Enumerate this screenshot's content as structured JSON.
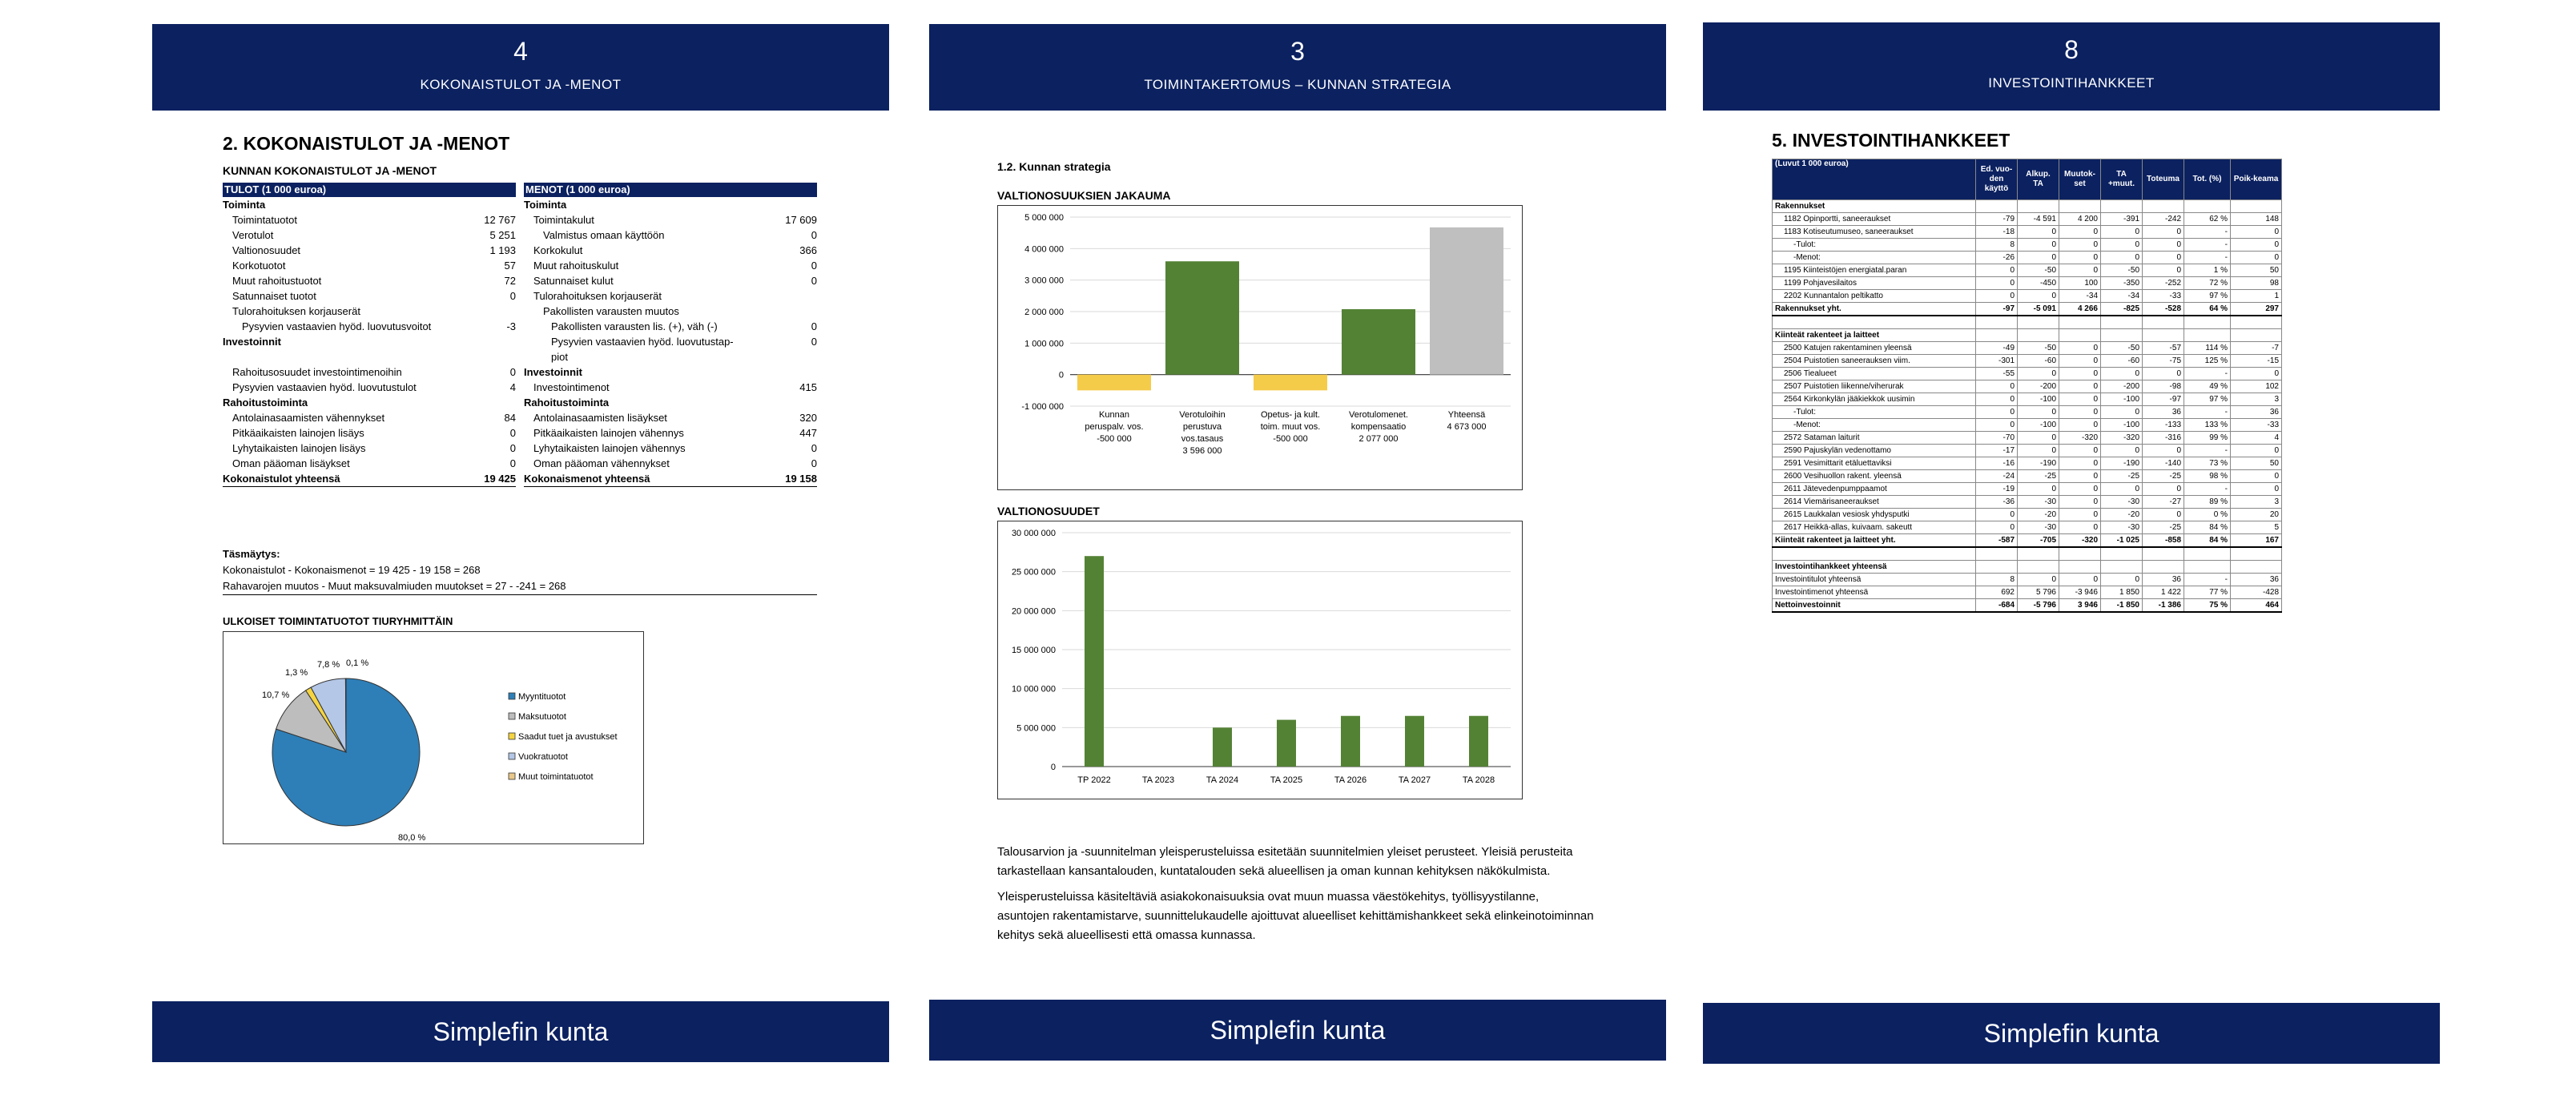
{
  "pages": [
    {
      "number": "4",
      "title": "KOKONAISTULOT JA -MENOT",
      "footer": "Simplefin kunta",
      "heading": "2.  KOKONAISTULOT JA -MENOT",
      "table_title": "KUNNAN KOKONAISTULOT JA -MENOT",
      "income": {
        "header": "TULOT (1 000 euroa)",
        "rows": [
          {
            "label": "Toiminta",
            "value": "",
            "style": "b",
            "indent": 0
          },
          {
            "label": "Toimintatuotot",
            "value": "12 767",
            "style": "",
            "indent": 1
          },
          {
            "label": "Verotulot",
            "value": "5 251",
            "style": "",
            "indent": 1
          },
          {
            "label": "Valtionosuudet",
            "value": "1 193",
            "style": "",
            "indent": 1
          },
          {
            "label": "Korkotuotot",
            "value": "57",
            "style": "",
            "indent": 1
          },
          {
            "label": "Muut rahoitustuotot",
            "value": "72",
            "style": "",
            "indent": 1
          },
          {
            "label": "Satunnaiset tuotot",
            "value": "0",
            "style": "",
            "indent": 1
          },
          {
            "label": "Tulorahoituksen korjauserät",
            "value": "",
            "style": "",
            "indent": 1
          },
          {
            "label": "Pysyvien vastaavien hyöd. luovutusvoitot",
            "value": "-3",
            "style": "",
            "indent": 2
          },
          {
            "label": "Investoinnit",
            "value": "",
            "style": "b",
            "indent": 0
          },
          {
            "label": "",
            "value": "",
            "style": "gap",
            "indent": 0
          },
          {
            "label": "Rahoitusosuudet investointimenoihin",
            "value": "0",
            "style": "",
            "indent": 1
          },
          {
            "label": "Pysyvien vastaavien hyöd. luovutustulot",
            "value": "4",
            "style": "",
            "indent": 1
          },
          {
            "label": "Rahoitustoiminta",
            "value": "",
            "style": "b",
            "indent": 0
          },
          {
            "label": "Antolainasaamisten vähennykset",
            "value": "84",
            "style": "",
            "indent": 1
          },
          {
            "label": "Pitkäaikaisten lainojen lisäys",
            "value": "0",
            "style": "",
            "indent": 1
          },
          {
            "label": "Lyhytaikaisten lainojen lisäys",
            "value": "0",
            "style": "",
            "indent": 1
          },
          {
            "label": "Oman pääoman lisäykset",
            "value": "0",
            "style": "",
            "indent": 1
          },
          {
            "label": "Kokonaistulot yhteensä",
            "value": "19 425",
            "style": "b2",
            "indent": 0
          }
        ]
      },
      "expenses": {
        "header": "MENOT (1 000 euroa)",
        "rows": [
          {
            "label": "Toiminta",
            "value": "",
            "style": "b",
            "indent": 0
          },
          {
            "label": "Toimintakulut",
            "value": "17 609",
            "style": "",
            "indent": 1
          },
          {
            "label": "Valmistus omaan käyttöön",
            "value": "0",
            "style": "",
            "indent": 2
          },
          {
            "label": "Korkokulut",
            "value": "366",
            "style": "",
            "indent": 1
          },
          {
            "label": "Muut rahoituskulut",
            "value": "0",
            "style": "",
            "indent": 1
          },
          {
            "label": "Satunnaiset kulut",
            "value": "0",
            "style": "",
            "indent": 1
          },
          {
            "label": "Tulorahoituksen korjauserät",
            "value": "",
            "style": "",
            "indent": 1
          },
          {
            "label": "Pakollisten varausten muutos",
            "value": "",
            "style": "",
            "indent": 2
          },
          {
            "label": "Pakollisten varausten lis. (+), väh (-)",
            "value": "0",
            "style": "",
            "indent": 3
          },
          {
            "label": "Pysyvien vastaavien hyöd. luovutustap-",
            "value": "0",
            "style": "",
            "indent": 3
          },
          {
            "label": "piot",
            "value": "",
            "style": "",
            "indent": 3
          },
          {
            "label": "Investoinnit",
            "value": "",
            "style": "b",
            "indent": 0
          },
          {
            "label": "Investointimenot",
            "value": "415",
            "style": "",
            "indent": 1
          },
          {
            "label": "Rahoitustoiminta",
            "value": "",
            "style": "b",
            "indent": 0
          },
          {
            "label": "Antolainasaamisten lisäykset",
            "value": "320",
            "style": "",
            "indent": 1
          },
          {
            "label": "Pitkäaikaisten lainojen vähennys",
            "value": "447",
            "style": "",
            "indent": 1
          },
          {
            "label": "Lyhytaikaisten lainojen vähennys",
            "value": "0",
            "style": "",
            "indent": 1
          },
          {
            "label": "Oman pääoman vähennykset",
            "value": "0",
            "style": "",
            "indent": 1
          },
          {
            "label": "Kokonaismenot yhteensä",
            "value": "19 158",
            "style": "b2",
            "indent": 0
          }
        ]
      },
      "reconciliation_title": "Täsmäytys:",
      "reconciliation_line1": "Kokonaistulot - Kokonaismenot  = 19 425 - 19 158 = 268",
      "reconciliation_line2": "Rahavarojen muutos - Muut maksuvalmiuden muutokset = 27 - -241 = 268",
      "pie_title": "ULKOISET TOIMINTATUOTOT TIURYHMITTÄIN"
    },
    {
      "number": "3",
      "title": "TOIMINTAKERTOMUS – KUNNAN STRATEGIA",
      "footer": "Simplefin kunta",
      "section": "1.2. Kunnan strategia",
      "chart1_title": "VALTIONOSUUKSIEN JAKAUMA",
      "chart2_title": "VALTIONOSUUDET",
      "paragraph1": "Talousarvion ja -suunnitelman yleisperusteluissa esitetään suunnitelmien yleiset perusteet. Yleisiä perusteita tarkastellaan kansantalouden, kuntatalouden sekä alueellisen ja oman kunnan kehityksen näkökulmista.",
      "paragraph2": "Yleisperusteluissa käsiteltäviä asiakokonaisuuksia ovat muun muassa väestökehitys, työllisyystilanne, asuntojen rakentamistarve, suunnittelukaudelle ajoittuvat alueelliset kehittämishankkeet sekä elinkeinotoiminnan kehitys sekä alueellisesti että omassa kunnassa."
    },
    {
      "number": "8",
      "title": "INVESTOINTIHANKKEET",
      "footer": "Simplefin kunta",
      "heading": "5.  INVESTOINTIHANKKEET",
      "table": {
        "columns": [
          "(Luvut 1 000 euroa)",
          "Ed. vuo-den käyttö",
          "Alkup. TA",
          "Muutok-set",
          "TA +muut.",
          "Toteuma",
          "Tot. (%)",
          "Poik-keama"
        ],
        "rows": [
          {
            "style": "sec",
            "cells": [
              "Rakennukset",
              "",
              "",
              "",
              "",
              "",
              "",
              ""
            ]
          },
          {
            "style": "",
            "cells": [
              "1182 Opinportti, saneeraukset",
              "-79",
              "-4 591",
              "4 200",
              "-391",
              "-242",
              "62 %",
              "148"
            ]
          },
          {
            "style": "",
            "cells": [
              "1183 Kotiseutumuseo, saneeraukset",
              "-18",
              "0",
              "0",
              "0",
              "0",
              "-",
              "0"
            ]
          },
          {
            "style": "",
            "cells": [
              "-Tulot:",
              "8",
              "0",
              "0",
              "0",
              "0",
              "-",
              "0"
            ]
          },
          {
            "style": "",
            "cells": [
              "-Menot:",
              "-26",
              "0",
              "0",
              "0",
              "0",
              "-",
              "0"
            ]
          },
          {
            "style": "",
            "cells": [
              "1195 Kiinteistöjen energiatal.paran",
              "0",
              "-50",
              "0",
              "-50",
              "0",
              "1 %",
              "50"
            ]
          },
          {
            "style": "",
            "cells": [
              "1199 Pohjavesilaitos",
              "0",
              "-450",
              "100",
              "-350",
              "-252",
              "72 %",
              "98"
            ]
          },
          {
            "style": "",
            "cells": [
              "2202 Kunnantalon peltikatto",
              "0",
              "0",
              "-34",
              "-34",
              "-33",
              "97 %",
              "1"
            ]
          },
          {
            "style": "tot",
            "cells": [
              "Rakennukset yht.",
              "-97",
              "-5 091",
              "4 266",
              "-825",
              "-528",
              "64 %",
              "297"
            ]
          },
          {
            "style": "",
            "cells": [
              "",
              "",
              "",
              "",
              "",
              "",
              "",
              ""
            ]
          },
          {
            "style": "sec",
            "cells": [
              "Kiinteät rakenteet ja laitteet",
              "",
              "",
              "",
              "",
              "",
              "",
              ""
            ]
          },
          {
            "style": "",
            "cells": [
              "2500 Katujen rakentaminen yleensä",
              "-49",
              "-50",
              "0",
              "-50",
              "-57",
              "114 %",
              "-7"
            ]
          },
          {
            "style": "",
            "cells": [
              "2504 Puistotien saneerauksen viim.",
              "-301",
              "-60",
              "0",
              "-60",
              "-75",
              "125 %",
              "-15"
            ]
          },
          {
            "style": "",
            "cells": [
              "2506 Tiealueet",
              "-55",
              "0",
              "0",
              "0",
              "0",
              "-",
              "0"
            ]
          },
          {
            "style": "",
            "cells": [
              "2507 Puistotien liikenne/viherurak",
              "0",
              "-200",
              "0",
              "-200",
              "-98",
              "49 %",
              "102"
            ]
          },
          {
            "style": "",
            "cells": [
              "2564 Kirkonkylän jääkiekkok uusimin",
              "0",
              "-100",
              "0",
              "-100",
              "-97",
              "97 %",
              "3"
            ]
          },
          {
            "style": "",
            "cells": [
              "-Tulot:",
              "0",
              "0",
              "0",
              "0",
              "36",
              "-",
              "36"
            ]
          },
          {
            "style": "",
            "cells": [
              "-Menot:",
              "0",
              "-100",
              "0",
              "-100",
              "-133",
              "133 %",
              "-33"
            ]
          },
          {
            "style": "",
            "cells": [
              "2572 Sataman laiturit",
              "-70",
              "0",
              "-320",
              "-320",
              "-316",
              "99 %",
              "4"
            ]
          },
          {
            "style": "",
            "cells": [
              "2590 Pajuskylän vedenottamo",
              "-17",
              "0",
              "0",
              "0",
              "0",
              "-",
              "0"
            ]
          },
          {
            "style": "",
            "cells": [
              "2591 Vesimittarit etäluettaviksi",
              "-16",
              "-190",
              "0",
              "-190",
              "-140",
              "73 %",
              "50"
            ]
          },
          {
            "style": "",
            "cells": [
              "2600 Vesihuollon rakent. yleensä",
              "-24",
              "-25",
              "0",
              "-25",
              "-25",
              "98 %",
              "0"
            ]
          },
          {
            "style": "",
            "cells": [
              "2611 Jätevedenpumppaamot",
              "-19",
              "0",
              "0",
              "0",
              "0",
              "-",
              "0"
            ]
          },
          {
            "style": "",
            "cells": [
              "2614 Viemärisaneeraukset",
              "-36",
              "-30",
              "0",
              "-30",
              "-27",
              "89 %",
              "3"
            ]
          },
          {
            "style": "",
            "cells": [
              "2615 Laukkalan vesiosk yhdysputki",
              "0",
              "-20",
              "0",
              "-20",
              "0",
              "0 %",
              "20"
            ]
          },
          {
            "style": "",
            "cells": [
              "2617 Heikkä-allas, kuivaam. sakeutt",
              "0",
              "-30",
              "0",
              "-30",
              "-25",
              "84 %",
              "5"
            ]
          },
          {
            "style": "tot",
            "cells": [
              "Kiinteät rakenteet ja laitteet yht.",
              "-587",
              "-705",
              "-320",
              "-1 025",
              "-858",
              "84 %",
              "167"
            ]
          },
          {
            "style": "",
            "cells": [
              "",
              "",
              "",
              "",
              "",
              "",
              "",
              ""
            ]
          },
          {
            "style": "sec",
            "cells": [
              "Investointihankkeet yhteensä",
              "",
              "",
              "",
              "",
              "",
              "",
              ""
            ]
          },
          {
            "style": "",
            "cells": [
              "Investointitulot yhteensä",
              "8",
              "0",
              "0",
              "0",
              "36",
              "-",
              "36"
            ]
          },
          {
            "style": "",
            "cells": [
              "Investointimenot yhteensä",
              "692",
              "5 796",
              "-3 946",
              "1 850",
              "1 422",
              "77 %",
              "-428"
            ]
          },
          {
            "style": "tot",
            "cells": [
              "Nettoinvestoinnit",
              "-684",
              "-5 796",
              "3 946",
              "-1 850",
              "-1 386",
              "75 %",
              "464"
            ]
          }
        ]
      }
    }
  ],
  "chart_data": [
    {
      "type": "pie",
      "title": "ULKOISET TOIMINTATUOTOT TIURYHMITTÄIN",
      "categories": [
        "Myyntituotot",
        "Maksutuotot",
        "Saadut tuet ja avustukset",
        "Vuokratuotot",
        "Muut toimintatuotot"
      ],
      "values": [
        80.0,
        10.7,
        1.3,
        7.8,
        0.1
      ],
      "labels": [
        "80,0 %",
        "10,7 %",
        "1,3 %",
        "7,8 %",
        "0,1 %"
      ],
      "colors": [
        "#2e7fb8",
        "#bdbdbd",
        "#f5d442",
        "#b4c7e7",
        "#e8c88a"
      ],
      "legend": "right"
    },
    {
      "type": "bar",
      "title": "VALTIONOSUUKSIEN JAKAUMA",
      "subtype": "waterfall",
      "categories": [
        "Kunnan peruspalv. vos.",
        "Verotuloihin perustuva vos.tasaus",
        "Opetus- ja kult. toim. muut vos.",
        "Verotulomenet. kompensaatio",
        "Yhteensä"
      ],
      "values": [
        -500000,
        3596000,
        -500000,
        2077000,
        4673000
      ],
      "value_labels": [
        "-500 000",
        "3 596 000",
        "-500 000",
        "2 077 000",
        "4 673 000"
      ],
      "ylim": [
        -1000000,
        5000000
      ],
      "yticks": [
        "-1 000 000",
        "0",
        "1 000 000",
        "2 000 000",
        "3 000 000",
        "4 000 000",
        "5 000 000"
      ],
      "colors": {
        "negative": "#f5cb4a",
        "positive": "#548235",
        "total": "#bfbfbf"
      }
    },
    {
      "type": "bar",
      "title": "VALTIONOSUUDET",
      "categories": [
        "TP 2022",
        "TA 2023",
        "TA 2024",
        "TA 2025",
        "TA 2026",
        "TA 2027",
        "TA 2028"
      ],
      "values": [
        27000000,
        0,
        5000000,
        6000000,
        6500000,
        6500000,
        6500000
      ],
      "ylim": [
        0,
        30000000
      ],
      "yticks": [
        "0",
        "5 000 000",
        "10 000 000",
        "15 000 000",
        "20 000 000",
        "25 000 000",
        "30 000 000"
      ],
      "color": "#548235"
    }
  ]
}
